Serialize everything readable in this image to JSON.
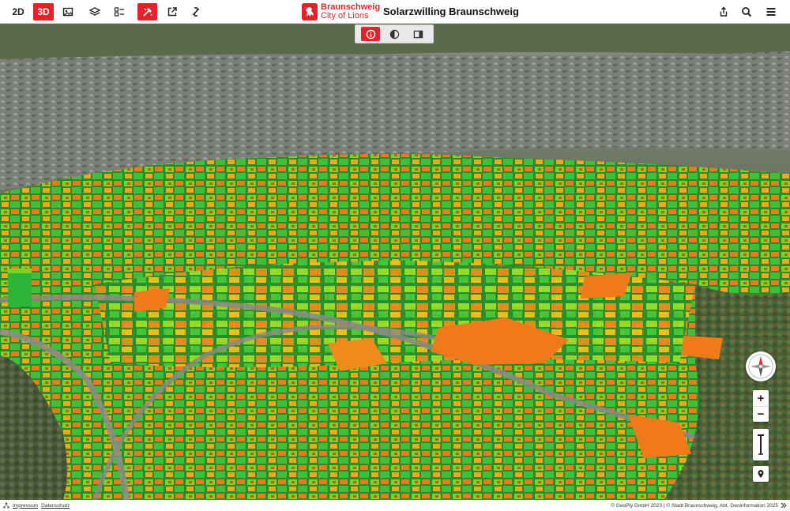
{
  "toolbar": {
    "btn_2d": "2D",
    "btn_3d": "3D",
    "icons": [
      "image-icon",
      "layers-icon",
      "legend-icon",
      "solar-tool-icon",
      "external-link-icon",
      "share-arrows-icon"
    ]
  },
  "brand": {
    "name": "Braunschweig",
    "subtitle": "City of Lions",
    "color": "#e4222a"
  },
  "app_title": "Solarzwilling Braunschweig",
  "header_right_icons": [
    "share-icon",
    "search-icon",
    "menu-icon"
  ],
  "subtoolbar_icons": [
    "info-icon",
    "shadow-icon",
    "split-view-icon"
  ],
  "map_controls": {
    "zoom_in": "+",
    "zoom_out": "−"
  },
  "footer": {
    "imprint": "Impressum",
    "privacy": "Datenschutz",
    "credits": "© GeoPly GmbH 2023 | © Stadt Braunschweig, Abt. Geoinformation 2025"
  },
  "colors": {
    "accent": "#e4222a",
    "solar_high": "#f07a1a",
    "solar_mid": "#8fd11f",
    "solar_low": "#1fb43a"
  }
}
